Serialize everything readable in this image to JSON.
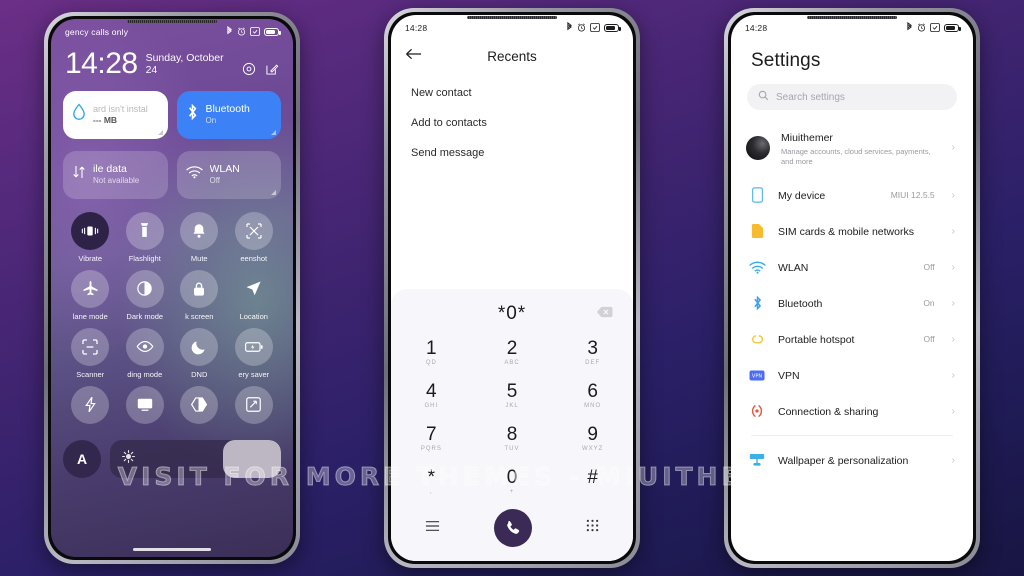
{
  "background": {
    "gradient_from": "#6b2f86",
    "gradient_to": "#181542"
  },
  "watermark": {
    "text": "VISIT FOR MORE THEMES - MIUITHEMER.COM"
  },
  "phone1": {
    "statusbar": {
      "carrier": "gency calls only",
      "icons": [
        "bluetooth-icon",
        "alarm-icon",
        "screenshot-icon",
        "battery-icon"
      ]
    },
    "clock": {
      "time": "14:28",
      "date": "Sunday, October 24"
    },
    "header_actions": [
      "settings-gear-icon",
      "edit-icon"
    ],
    "tiles": [
      {
        "title": "ard isn't instal",
        "sub": "--- MB",
        "style": "light",
        "icon": "data-drop-icon"
      },
      {
        "title": "Bluetooth",
        "sub": "On",
        "style": "blue",
        "icon": "bluetooth-icon"
      },
      {
        "title": "ile data",
        "sub": "Not available",
        "style": "glass",
        "icon": "mobile-data-icon"
      },
      {
        "title": "WLAN",
        "sub": "Off",
        "style": "glass",
        "icon": "wifi-icon"
      }
    ],
    "toggles": [
      {
        "label": "Vibrate",
        "icon": "vibrate-icon",
        "active": true
      },
      {
        "label": "Flashlight",
        "icon": "flashlight-icon",
        "active": false
      },
      {
        "label": "Mute",
        "icon": "bell-icon",
        "active": false
      },
      {
        "label": "eenshot",
        "icon": "screenshot-icon",
        "active": false
      },
      {
        "label": "lane mode",
        "icon": "airplane-icon",
        "active": false
      },
      {
        "label": "Dark mode",
        "icon": "dark-mode-icon",
        "active": false
      },
      {
        "label": "k screen",
        "icon": "lock-icon",
        "active": false
      },
      {
        "label": "Location",
        "icon": "location-icon",
        "active": false
      },
      {
        "label": "Scanner",
        "icon": "scanner-icon",
        "active": false
      },
      {
        "label": "ding mode",
        "icon": "reading-mode-icon",
        "active": false
      },
      {
        "label": "DND",
        "icon": "moon-icon",
        "active": false
      },
      {
        "label": "ery saver",
        "icon": "battery-saver-icon",
        "active": false
      },
      {
        "label": "",
        "icon": "lightning-icon",
        "active": false
      },
      {
        "label": "",
        "icon": "cast-icon",
        "active": false
      },
      {
        "label": "",
        "icon": "theme-icon",
        "active": false
      },
      {
        "label": "",
        "icon": "rotate-icon",
        "active": false
      }
    ],
    "brightness": {
      "auto_label": "A",
      "icon": "brightness-icon",
      "fill_percent": 34
    }
  },
  "phone2": {
    "statusbar": {
      "time": "14:28"
    },
    "header": {
      "back_icon": "back-arrow-icon",
      "title": "Recents"
    },
    "menu_items": [
      "New contact",
      "Add to contacts",
      "Send message"
    ],
    "keypad": {
      "display_value": "*0*",
      "delete_icon": "backspace-icon",
      "keys": [
        {
          "digit": "1",
          "letters": "QD"
        },
        {
          "digit": "2",
          "letters": "ABC"
        },
        {
          "digit": "3",
          "letters": "DEF"
        },
        {
          "digit": "4",
          "letters": "GHI"
        },
        {
          "digit": "5",
          "letters": "JKL"
        },
        {
          "digit": "6",
          "letters": "MNO"
        },
        {
          "digit": "7",
          "letters": "PQRS"
        },
        {
          "digit": "8",
          "letters": "TUV"
        },
        {
          "digit": "9",
          "letters": "WXYZ"
        },
        {
          "digit": "*",
          "letters": ","
        },
        {
          "digit": "0",
          "letters": "+"
        },
        {
          "digit": "#",
          "letters": ""
        }
      ],
      "bottom": {
        "menu_icon": "menu-icon",
        "call_icon": "call-icon",
        "dialpad_icon": "dialpad-icon",
        "call_button_color": "#3b2a55"
      }
    }
  },
  "phone3": {
    "statusbar": {
      "time": "14:28"
    },
    "title": "Settings",
    "search": {
      "placeholder": "Search settings",
      "icon": "search-icon"
    },
    "account": {
      "name": "Miuithemer",
      "sub": "Manage accounts, cloud services, payments, and more"
    },
    "device": {
      "label": "My device",
      "value": "MIUI 12.5.5",
      "icon": "device-icon",
      "color": "#5ab8e8"
    },
    "items": [
      {
        "label": "SIM cards & mobile networks",
        "value": "",
        "icon": "sim-icon",
        "color": "#f7bc2e"
      },
      {
        "label": "WLAN",
        "value": "Off",
        "icon": "wifi-icon",
        "color": "#37b0f1"
      },
      {
        "label": "Bluetooth",
        "value": "On",
        "icon": "bluetooth-icon",
        "color": "#3b9ff1"
      },
      {
        "label": "Portable hotspot",
        "value": "Off",
        "icon": "hotspot-icon",
        "color": "#f5c93d"
      },
      {
        "label": "VPN",
        "value": "",
        "icon": "vpn-icon",
        "color": "#4a6cf7"
      },
      {
        "label": "Connection & sharing",
        "value": "",
        "icon": "connection-icon",
        "color": "#e4553c"
      }
    ],
    "items2": [
      {
        "label": "Wallpaper & personalization",
        "value": "",
        "icon": "wallpaper-icon",
        "color": "#3db0ea"
      }
    ]
  }
}
